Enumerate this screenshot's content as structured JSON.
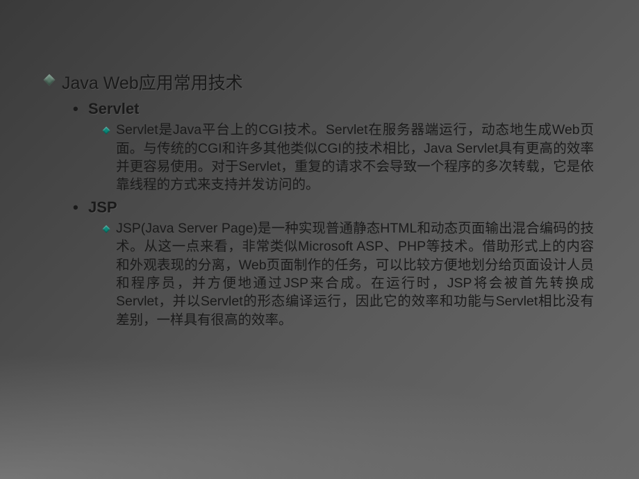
{
  "slide": {
    "title": "Java Web应用常用技术",
    "sections": [
      {
        "heading": "Servlet",
        "body": "Servlet是Java平台上的CGI技术。Servlet在服务器端运行，动态地生成Web页面。与传统的CGI和许多其他类似CGI的技术相比，Java Servlet具有更高的效率并更容易使用。对于Servlet，重复的请求不会导致一个程序的多次转载，它是依靠线程的方式来支持并发访问的。"
      },
      {
        "heading": "JSP",
        "body": "JSP(Java Server Page)是一种实现普通静态HTML和动态页面输出混合编码的技术。从这一点来看，非常类似Microsoft ASP、PHP等技术。借助形式上的内容和外观表现的分离，Web页面制作的任务，可以比较方便地划分给页面设计人员和程序员，并方便地通过JSP来合成。在运行时，JSP将会被首先转换成Servlet，并以Servlet的形态编译运行，因此它的效率和功能与Servlet相比没有差别，一样具有很高的效率。"
      }
    ]
  }
}
